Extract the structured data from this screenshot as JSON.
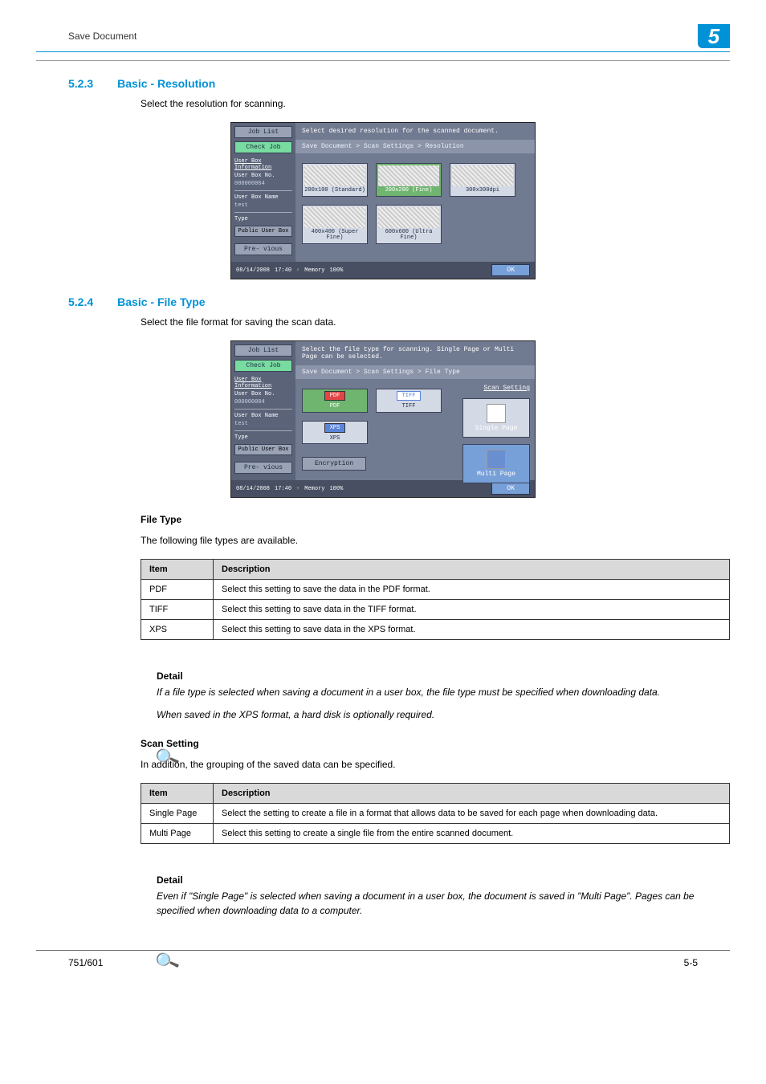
{
  "header": {
    "title": "Save Document",
    "chapter": "5"
  },
  "s523": {
    "num": "5.2.3",
    "title": "Basic - Resolution",
    "intro": "Select the resolution for scanning."
  },
  "s524": {
    "num": "5.2.4",
    "title": "Basic - File Type",
    "intro": "Select the file format for saving the scan data."
  },
  "shot_common": {
    "job_list": "Job List",
    "check_job": "Check Job",
    "userbox_info": "User Box\nInformation",
    "userbox_no_lbl": "User Box No.",
    "userbox_no_val": "000000004",
    "userbox_name_lbl": "User Box Name",
    "userbox_name_val": "test",
    "type_lbl": "Type",
    "type_val": "Public\nUser Box",
    "prev_btn": "Pre-\nvious",
    "date": "08/14/2008",
    "time": "17:40",
    "memory": "Memory",
    "mempct": "100%",
    "ok": "OK"
  },
  "shot1": {
    "msg": "Select desired resolution\nfor the scanned document.",
    "crumb": "Save Document > Scan Settings > Resolution",
    "opts": [
      "200x100 (Standard)",
      "200x200 (Fine)",
      "300x300dpi",
      "400x400\n(Super Fine)",
      "600x600\n(Ultra Fine)"
    ]
  },
  "shot2": {
    "msg": "Select the file type for scanning.\nSingle Page or Multi Page can be selected.",
    "crumb": "Save Document > Scan Settings > File Type",
    "scan_setting": "Scan\nSetting",
    "opts": {
      "pdf": "PDF",
      "tiff": "TIFF",
      "xps": "XPS"
    },
    "rc": {
      "single": "Single Page",
      "multi": "Multi Page"
    },
    "encryption": "Encryption"
  },
  "ft_section": {
    "head": "File Type",
    "intro": "The following file types are available.",
    "th_item": "Item",
    "th_desc": "Description",
    "rows": [
      {
        "item": "PDF",
        "desc": "Select this setting to save the data in the PDF format."
      },
      {
        "item": "TIFF",
        "desc": "Select this setting to save data in the TIFF format."
      },
      {
        "item": "XPS",
        "desc": "Select this setting to save data in the XPS format."
      }
    ]
  },
  "detail_label": "Detail",
  "detail1a": "If a file type is selected when saving a document in a user box, the file type must be specified when downloading data.",
  "detail1b": "When saved in the XPS format, a hard disk is optionally required.",
  "ss_section": {
    "head": "Scan Setting",
    "intro": "In addition, the grouping of the saved data can be specified.",
    "th_item": "Item",
    "th_desc": "Description",
    "rows": [
      {
        "item": "Single Page",
        "desc": "Select the setting to create a file in a format that allows data to be saved for each page when downloading data."
      },
      {
        "item": "Multi Page",
        "desc": "Select this setting to create a single file from the entire scanned document."
      }
    ]
  },
  "detail2": "Even if \"Single Page\" is selected when saving a document in a user box, the document is saved in \"Multi Page\". Pages can be specified when downloading data to a computer.",
  "footer": {
    "left": "751/601",
    "right": "5-5"
  }
}
